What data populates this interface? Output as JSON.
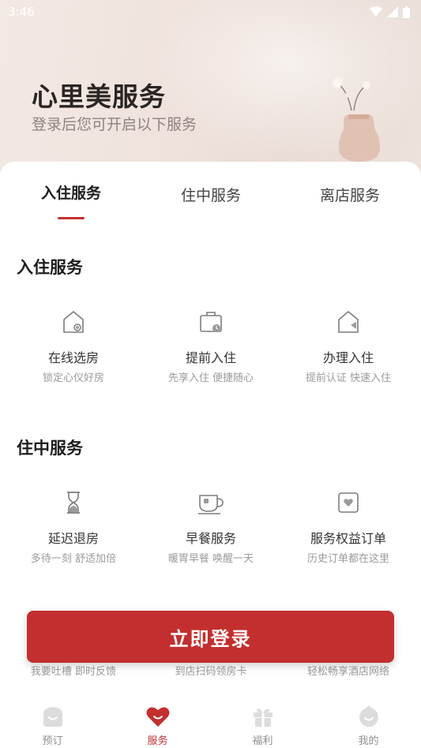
{
  "status_bar": {
    "time": "3:46"
  },
  "hero": {
    "title": "心里美服务",
    "subtitle": "登录后您可开启以下服务"
  },
  "tabs": [
    {
      "label": "入住服务",
      "active": true
    },
    {
      "label": "住中服务",
      "active": false
    },
    {
      "label": "离店服务",
      "active": false
    }
  ],
  "sections": [
    {
      "title": "入住服务",
      "items": [
        {
          "name": "在线选房",
          "desc": "锁定心仪好房",
          "icon": "house-search-icon"
        },
        {
          "name": "提前入住",
          "desc": "先享入住 便捷随心",
          "icon": "luggage-clock-icon"
        },
        {
          "name": "办理入住",
          "desc": "提前认证 快速入住",
          "icon": "house-checkin-icon"
        }
      ]
    },
    {
      "title": "住中服务",
      "items": [
        {
          "name": "延迟退房",
          "desc": "多待一刻 舒适加倍",
          "icon": "hourglass-icon"
        },
        {
          "name": "早餐服务",
          "desc": "暖胃早餐 唤醒一天",
          "icon": "coffee-cup-icon"
        },
        {
          "name": "服务权益订单",
          "desc": "历史订单都在这里",
          "icon": "order-card-icon"
        }
      ]
    }
  ],
  "partial_row": [
    "我要吐槽 即时反馈",
    "到店扫码领房卡",
    "轻松畅享酒店网络"
  ],
  "login_button": "立即登录",
  "bottom_nav": [
    {
      "label": "预订",
      "icon": "booking-icon",
      "active": false
    },
    {
      "label": "服务",
      "icon": "heart-smile-icon",
      "active": true
    },
    {
      "label": "福利",
      "icon": "gift-icon",
      "active": false
    },
    {
      "label": "我的",
      "icon": "profile-icon",
      "active": false
    }
  ],
  "colors": {
    "accent": "#c22f2e",
    "icon_gray": "#7c7c7c",
    "nav_inactive": "#d9d9d9"
  }
}
